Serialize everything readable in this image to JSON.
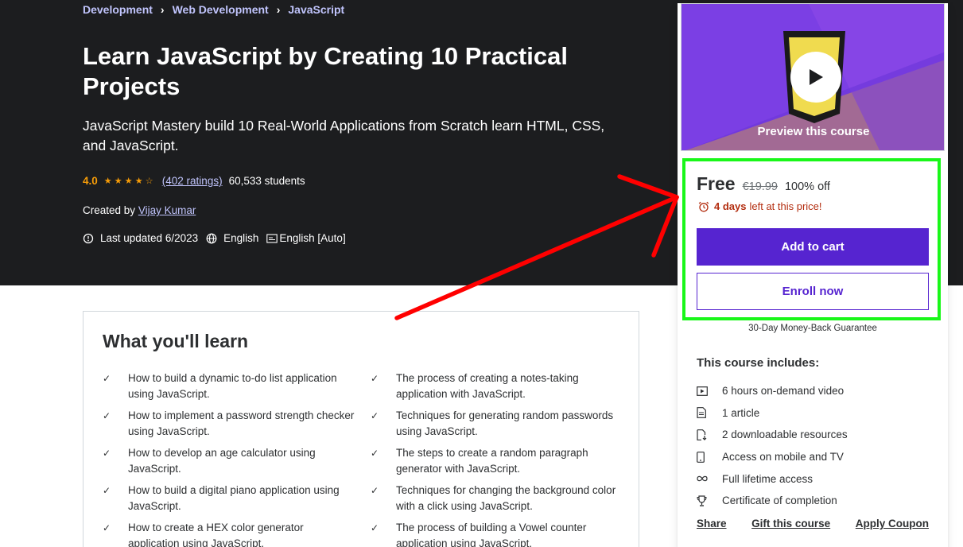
{
  "breadcrumb": {
    "items": [
      "Development",
      "Web Development",
      "JavaScript"
    ],
    "separator": "›"
  },
  "course": {
    "title": "Learn JavaScript by Creating 10 Practical Projects",
    "subtitle": "JavaScript Mastery build 10 Real-World Applications from Scratch learn HTML, CSS, and JavaScript.",
    "rating": "4.0",
    "stars_filled": 4,
    "stars_total": 5,
    "ratings_count": "(402 ratings)",
    "students": "60,533 students",
    "created_by_label": "Created by",
    "author": "Vijay Kumar",
    "last_updated": "Last updated 6/2023",
    "language": "English",
    "captions": "English [Auto]"
  },
  "learn": {
    "title": "What you'll learn",
    "items": [
      "How to build a dynamic to-do list application using JavaScript.",
      "The process of creating a notes-taking application with JavaScript.",
      "How to implement a password strength checker using JavaScript.",
      "Techniques for generating random passwords using JavaScript.",
      "How to develop an age calculator using JavaScript.",
      "The steps to create a random paragraph generator with JavaScript.",
      "How to build a digital piano application using JavaScript.",
      "Techniques for changing the background color with a click using JavaScript.",
      "How to create a HEX color generator application using JavaScript.",
      "The process of building a Vowel counter application using JavaScript."
    ]
  },
  "sidebar": {
    "preview_label": "Preview this course",
    "price": "Free",
    "original_price": "€19.99",
    "discount": "100% off",
    "timer_bold": "4 days",
    "timer_rest": "left at this price!",
    "add_to_cart": "Add to cart",
    "enroll_now": "Enroll now",
    "guarantee": "30-Day Money-Back Guarantee",
    "includes_title": "This course includes:",
    "includes": [
      {
        "icon": "video-icon",
        "label": "6 hours on-demand video"
      },
      {
        "icon": "article-icon",
        "label": "1 article"
      },
      {
        "icon": "download-file-icon",
        "label": "2 downloadable resources"
      },
      {
        "icon": "mobile-icon",
        "label": "Access on mobile and TV"
      },
      {
        "icon": "infinity-icon",
        "label": "Full lifetime access"
      },
      {
        "icon": "trophy-icon",
        "label": "Certificate of completion"
      }
    ],
    "links": {
      "share": "Share",
      "gift": "Gift this course",
      "coupon": "Apply Coupon"
    }
  },
  "colors": {
    "hero_bg": "#1c1d1f",
    "link_purple": "#c0c4fc",
    "rating_orange": "#f69c08",
    "primary_purple": "#5624d0",
    "timer_red": "#b32d0f",
    "highlight_green": "#19f719",
    "arrow_red": "#ff0000"
  }
}
